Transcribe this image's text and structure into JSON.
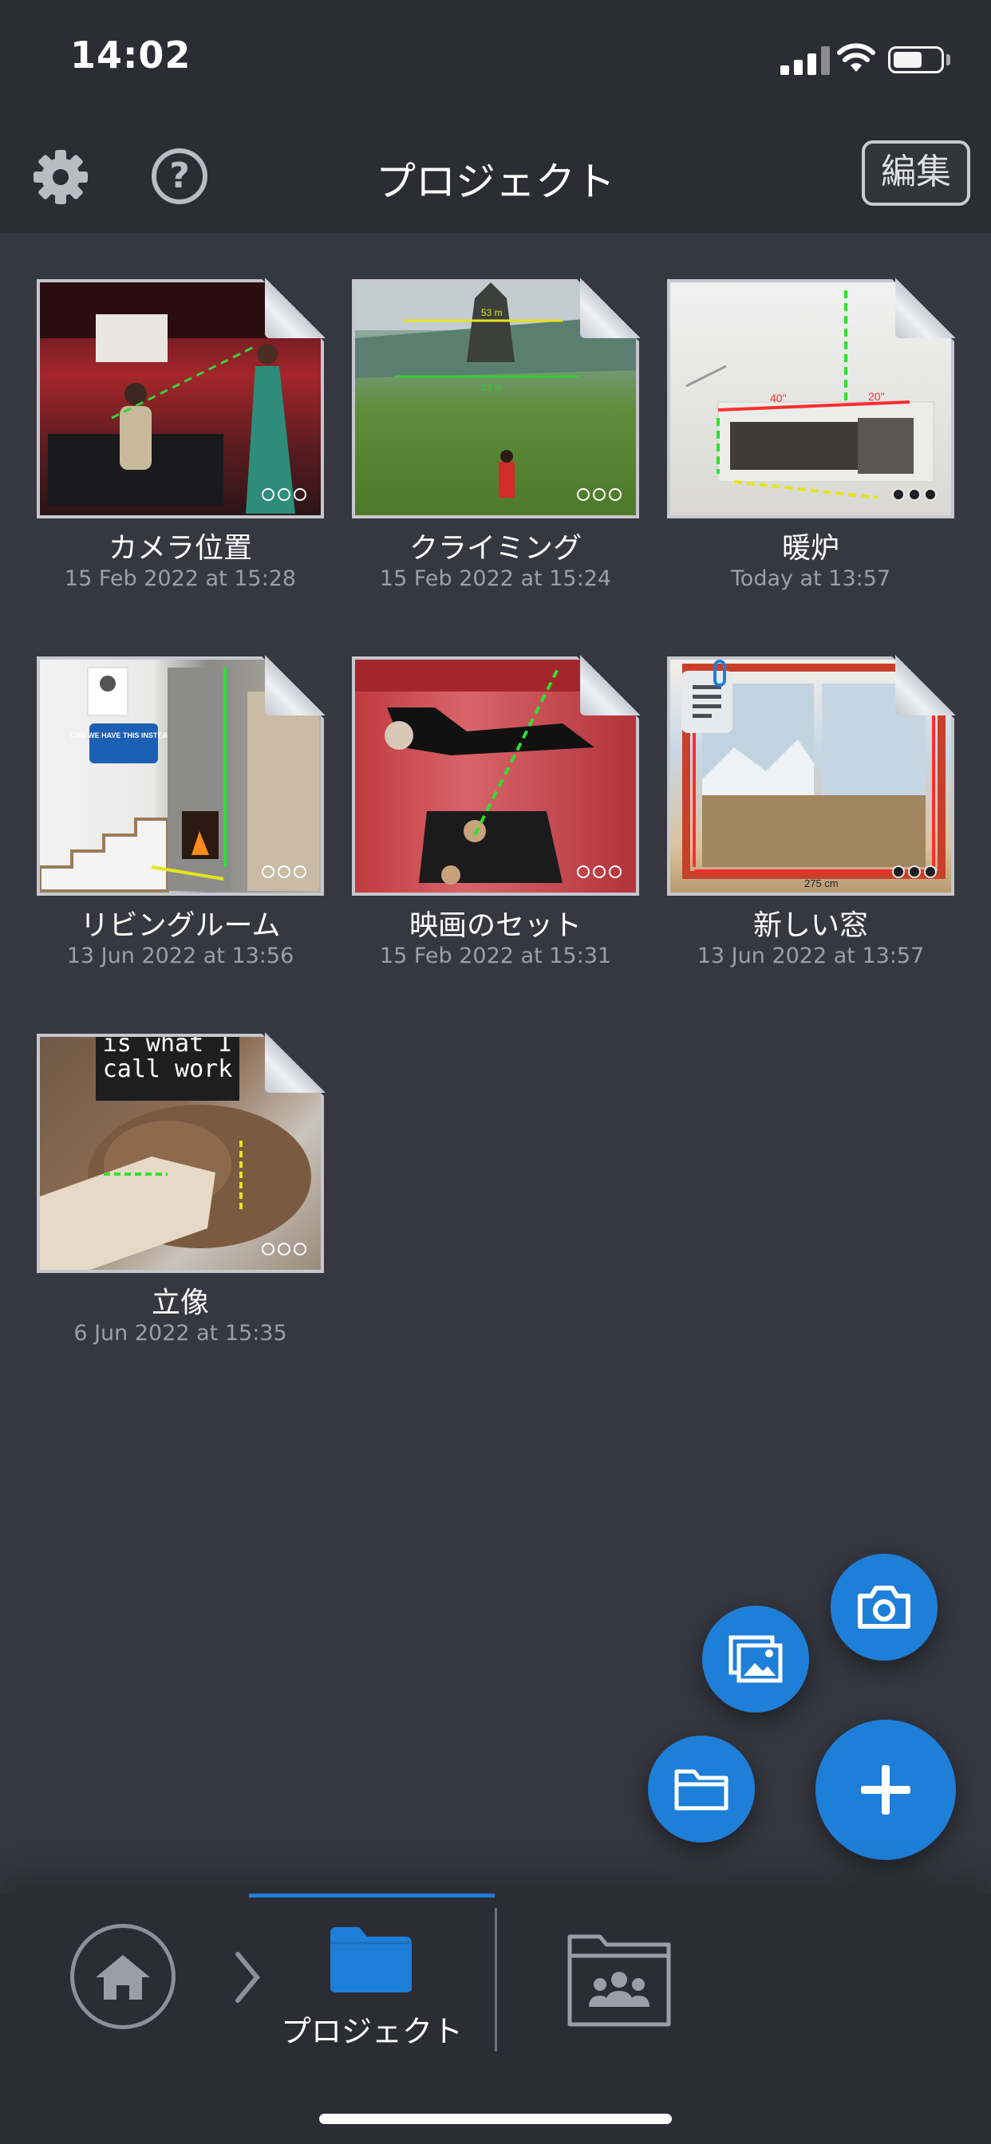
{
  "status_bar": {
    "time": "14:02",
    "battery_level": 0.62
  },
  "nav": {
    "title": "プロジェクト",
    "edit_label": "編集",
    "help_glyph": "?",
    "settings_icon": "gear-icon"
  },
  "projects": [
    {
      "title": "カメラ位置",
      "date": "15 Feb 2022 at 15:28",
      "dots_filled": false
    },
    {
      "title": "クライミング",
      "date": "15 Feb 2022 at 15:24",
      "dots_filled": false
    },
    {
      "title": "暖炉",
      "date": "Today at 13:57",
      "dots_filled": true
    },
    {
      "title": "リビングルーム",
      "date": "13 Jun 2022 at 13:56",
      "dots_filled": false
    },
    {
      "title": "映画のセット",
      "date": "15 Feb 2022 at 15:31",
      "dots_filled": false
    },
    {
      "title": "新しい窓",
      "date": "13 Jun 2022 at 13:57",
      "dots_filled": true
    },
    {
      "title": "立像",
      "date": "6 Jun 2022 at 15:35",
      "dots_filled": false
    }
  ],
  "thumb_text": {
    "stairs_sign": "CAN WE HAVE THIS INSTEAD?",
    "statue_sign_1": "is what I",
    "statue_sign_2": "call work",
    "climb_m1": "53 m",
    "climb_m2": "23 m",
    "fire_m1": "40\"",
    "fire_m2": "20\"",
    "window_m1": "275 cm"
  },
  "fab": {
    "camera_icon": "camera-icon",
    "gallery_icon": "gallery-icon",
    "folder_icon": "folder-icon",
    "plus_icon": "plus-icon"
  },
  "bottom_bar": {
    "active_tab_label": "プロジェクト"
  },
  "colors": {
    "accent": "#1e7fd8",
    "background": "#373741",
    "bar": "#2c2c35"
  }
}
